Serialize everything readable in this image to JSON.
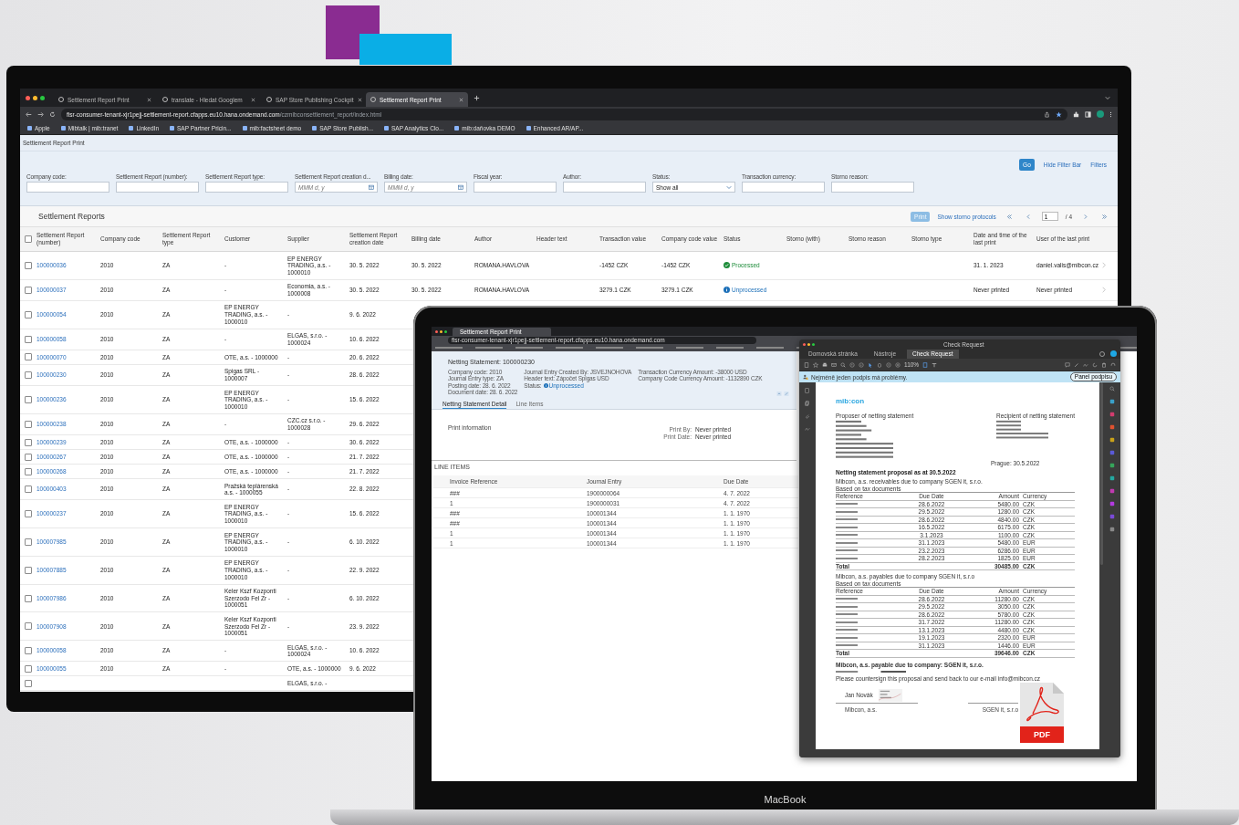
{
  "monitor": {
    "browser": {
      "tabs": [
        {
          "title": "Settlement Report Print",
          "selected": false
        },
        {
          "title": "translate - Hledat Googlem",
          "selected": false
        },
        {
          "title": "SAP Store Publishing Cockpit",
          "selected": false
        },
        {
          "title": "Settlement Report Print",
          "selected": true
        }
      ],
      "url_host": "fisr-consumer-tenant-xjr1pejj-settlement-report.cfapps.eu10.hana.ondemand.com",
      "url_path": "/czmibconsettlement_report/index.html",
      "bookmarks": [
        "Apple",
        "Mibtalk | mib:tranet",
        "LinkedIn",
        "SAP Partner Pricin...",
        "mib:factsheet demo",
        "SAP Store Publish...",
        "SAP Analytics Clo...",
        "mib:daňovka DEMO",
        "Enhanced AR/AP..."
      ]
    },
    "app_title": "Settlement Report Print",
    "filter_buttons": [
      {
        "label": "Go",
        "kind": "primary"
      },
      {
        "label": "Hide Filter Bar",
        "kind": "link"
      },
      {
        "label": "Filters",
        "kind": "link"
      }
    ],
    "filters": [
      {
        "label": "Company code:",
        "kind": "text"
      },
      {
        "label": "Settlement Report (number):",
        "kind": "text"
      },
      {
        "label": "Settlement Report type:",
        "kind": "text"
      },
      {
        "label": "Settlement Report creation d...",
        "kind": "date",
        "placeholder": "MMM d, y"
      },
      {
        "label": "Billing date:",
        "kind": "date",
        "placeholder": "MMM d, y"
      },
      {
        "label": "Fiscal year:",
        "kind": "text"
      },
      {
        "label": "Author:",
        "kind": "text"
      },
      {
        "label": "Status:",
        "kind": "select",
        "value": "Show all"
      },
      {
        "label": "Transaction currency:",
        "kind": "text"
      },
      {
        "label": "Storno reason:",
        "kind": "text"
      }
    ],
    "table": {
      "title": "Settlement Reports",
      "print": {
        "label": "Print",
        "disabled": true
      },
      "storno_link": "Show storno protocols",
      "page": "1",
      "pages": "/ 4",
      "all_checked": false,
      "columns": [
        "Settlement Report (number)",
        "Company code",
        "Settlement Report type",
        "Customer",
        "Supplier",
        "Settlement Report creation date",
        "Billing date",
        "Author",
        "Header text",
        "Transaction value",
        "Company code value",
        "Status",
        "Storno (with)",
        "Storno reason",
        "Storno type",
        "Date and time of the last print",
        "User of the last print"
      ],
      "rows": [
        {
          "checked": false,
          "number": "100000036",
          "company_code": "2010",
          "type": "ZA",
          "customer": "-",
          "supplier": "EP ENERGY TRADING, a.s. - 1000010",
          "creation_date": "30. 5. 2022",
          "billing_date": "30. 5. 2022",
          "author": "ROMANA.HAVLOVA",
          "transaction_value": "-1452 CZK",
          "company_code_value": "-1452 CZK",
          "status": {
            "text": "Processed",
            "kind": "success"
          },
          "last_print": "31. 1. 2023",
          "last_user": "daniel.valis@mibcon.cz",
          "openable": true
        },
        {
          "checked": false,
          "number": "100000037",
          "company_code": "2010",
          "type": "ZA",
          "customer": "-",
          "supplier": "Economia, a.s. - 1000008",
          "creation_date": "30. 5. 2022",
          "billing_date": "30. 5. 2022",
          "author": "ROMANA.HAVLOVA",
          "transaction_value": "3279.1 CZK",
          "company_code_value": "3279.1 CZK",
          "status": {
            "text": "Unprocessed",
            "kind": "info"
          },
          "last_print": "Never printed",
          "last_user": "Never printed",
          "openable": true
        },
        {
          "checked": false,
          "number": "100000054",
          "company_code": "2010",
          "type": "ZA",
          "customer": "EP ENERGY TRADING, a.s. - 1000010",
          "supplier": "-",
          "creation_date": "9. 6. 2022"
        },
        {
          "checked": false,
          "number": "100000058",
          "company_code": "2010",
          "type": "ZA",
          "customer": "-",
          "supplier": "ELGAS, s.r.o. - 1000024",
          "creation_date": "10. 6. 2022"
        },
        {
          "checked": false,
          "number": "100000070",
          "company_code": "2010",
          "type": "ZA",
          "customer": "OTE, a.s. - 1000000",
          "supplier": "-",
          "creation_date": "20. 6. 2022"
        },
        {
          "checked": false,
          "number": "100000230",
          "company_code": "2010",
          "type": "ZA",
          "customer": "Spigas SRL - 1000007",
          "supplier": "-",
          "creation_date": "28. 6. 2022"
        },
        {
          "checked": false,
          "number": "100000236",
          "company_code": "2010",
          "type": "ZA",
          "customer": "EP ENERGY TRADING, a.s. - 1000010",
          "supplier": "-",
          "creation_date": "15. 6. 2022"
        },
        {
          "checked": false,
          "number": "100000238",
          "company_code": "2010",
          "type": "ZA",
          "customer": "-",
          "supplier": "CZC.cz s.r.o. - 1000028",
          "creation_date": "29. 6. 2022"
        },
        {
          "checked": false,
          "number": "100000239",
          "company_code": "2010",
          "type": "ZA",
          "customer": "OTE, a.s. - 1000000",
          "supplier": "-",
          "creation_date": "30. 6. 2022"
        },
        {
          "checked": false,
          "number": "100000267",
          "company_code": "2010",
          "type": "ZA",
          "customer": "OTE, a.s. - 1000000",
          "supplier": "-",
          "creation_date": "21. 7. 2022"
        },
        {
          "checked": false,
          "number": "100000268",
          "company_code": "2010",
          "type": "ZA",
          "customer": "OTE, a.s. - 1000000",
          "supplier": "-",
          "creation_date": "21. 7. 2022"
        },
        {
          "checked": false,
          "number": "100000403",
          "company_code": "2010",
          "type": "ZA",
          "customer": "Pražská teplárenská a.s. - 1000055",
          "supplier": "-",
          "creation_date": "22. 8. 2022"
        },
        {
          "checked": false,
          "number": "100000237",
          "company_code": "2010",
          "type": "ZA",
          "customer": "EP ENERGY TRADING, a.s. - 1000010",
          "supplier": "-",
          "creation_date": "15. 6. 2022"
        },
        {
          "checked": false,
          "number": "100007985",
          "company_code": "2010",
          "type": "ZA",
          "customer": "EP ENERGY TRADING, a.s. - 1000010",
          "supplier": "-",
          "creation_date": "6. 10. 2022"
        },
        {
          "checked": false,
          "number": "100007885",
          "company_code": "2010",
          "type": "ZA",
          "customer": "EP ENERGY TRADING, a.s. - 1000010",
          "supplier": "-",
          "creation_date": "22. 9. 2022"
        },
        {
          "checked": false,
          "number": "100007986",
          "company_code": "2010",
          "type": "ZA",
          "customer": "Keler Kszf Kozponti Szerzodo Fel Zr - 1000051",
          "supplier": "-",
          "creation_date": "6. 10. 2022"
        },
        {
          "checked": false,
          "number": "100007908",
          "company_code": "2010",
          "type": "ZA",
          "customer": "Keler Kszf Kozponti Szerzodo Fel Zr - 1000051",
          "supplier": "-",
          "creation_date": "23. 9. 2022"
        },
        {
          "checked": false,
          "number": "100000058",
          "company_code": "2010",
          "type": "ZA",
          "customer": "-",
          "supplier": "ELGAS, s.r.o. - 1000024",
          "creation_date": "10. 6. 2022"
        },
        {
          "checked": false,
          "number": "100000055",
          "company_code": "2010",
          "type": "ZA",
          "customer": "-",
          "supplier": "OTE, a.s. - 1000000",
          "creation_date": "9. 6. 2022"
        },
        {
          "checked": false,
          "supplier": "ELGAS, s.r.o. -"
        }
      ]
    }
  },
  "laptop": {
    "brand": "MacBook",
    "browser": {
      "tabs": [
        {
          "title": "Settlement Report Print",
          "selected": true
        }
      ],
      "url_host": "fisr-consumer-tenant-xjr1pejj-settlement-report.cfapps.eu10.hana.ondemand.com"
    },
    "netting": {
      "title": "Netting Statement: 100000230",
      "details": [
        [
          "Company code: 2010",
          "Journal Entry type: ZA",
          "Posting date: 28. 6. 2022",
          "Document date: 28. 6. 2022"
        ],
        [
          "Journal Entry Created By: JSVEJNOHOVA",
          "Header text: Zápočet Spigas USD"
        ],
        [
          "Transaction Currency Amount: -38000 USD",
          "Company Code Currency Amount: -1132890 CZK"
        ]
      ],
      "status_label": "Status:",
      "status": {
        "text": "Unprocessed",
        "kind": "info"
      },
      "tabs": [
        {
          "label": "Netting Statement Detail",
          "selected": true
        },
        {
          "label": "Line Items",
          "selected": false
        }
      ],
      "print_title": "Print information",
      "print_fields": [
        {
          "label": "Print By:",
          "value": "Never printed"
        },
        {
          "label": "Print Date:",
          "value": "Never printed"
        }
      ],
      "line_items": {
        "title": "LINE ITEMS",
        "columns": [
          "Invoice Reference",
          "Journal Entry",
          "Due Date"
        ],
        "rows": [
          [
            "###",
            "1900000064",
            "4. 7. 2022"
          ],
          [
            "1",
            "1900000031",
            "4. 7. 2022"
          ],
          [
            "###",
            "100001344",
            "1. 1. 1970"
          ],
          [
            "###",
            "100001344",
            "1. 1. 1970"
          ],
          [
            "1",
            "100001344",
            "1. 1. 1970"
          ],
          [
            "1",
            "100001344",
            "1. 1. 1970"
          ]
        ]
      }
    },
    "pdf_viewer": {
      "title": "Check Request",
      "tabs": [
        {
          "label": "Domovská stránka",
          "selected": false
        },
        {
          "label": "Nástroje",
          "selected": false
        },
        {
          "label": "Check Request",
          "selected": true
        }
      ],
      "zoom": "110%",
      "notice": "Nejméně jeden podpis má problémy.",
      "notice_button": "Panel podpisu",
      "document": {
        "logo": "mib:con",
        "proposer_title": "Proposer of netting statement",
        "recipient_title": "Recipient of netting statement",
        "place_date": "Prague: 30.5.2022",
        "heading": "Netting statement proposal as at 30.5.2022",
        "sections": [
          {
            "title": "Mibcon, a.s. receivables due to company SGEN it, s.r.o.",
            "basis": "Based on tax documents",
            "columns": [
              "Reference",
              "Due Date",
              "Amount",
              "Currency"
            ],
            "rows": [
              {
                "due": "28.6.2022",
                "amount": "5480.00",
                "currency": "CZK"
              },
              {
                "due": "29.5.2022",
                "amount": "1280.00",
                "currency": "CZK"
              },
              {
                "due": "28.6.2022",
                "amount": "4840.00",
                "currency": "CZK"
              },
              {
                "due": "16.5.2022",
                "amount": "6175.00",
                "currency": "CZK"
              },
              {
                "due": "3.1.2023",
                "amount": "1100.00",
                "currency": "CZK"
              },
              {
                "due": "31.1.2023",
                "amount": "5480.00",
                "currency": "EUR"
              },
              {
                "due": "23.2.2023",
                "amount": "6286.00",
                "currency": "EUR"
              },
              {
                "due": "28.2.2023",
                "amount": "1825.00",
                "currency": "EUR"
              }
            ],
            "total": {
              "label": "Total",
              "amount": "30485.00",
              "currency": "CZK"
            }
          },
          {
            "title": "Mibcon, a.s. payables due to company SGEN it, s.r.o",
            "basis": "Based on tax documents",
            "columns": [
              "Reference",
              "Due Date",
              "Amount",
              "Currency"
            ],
            "rows": [
              {
                "due": "28.6.2022",
                "amount": "11280.00",
                "currency": "CZK"
              },
              {
                "due": "29.5.2022",
                "amount": "3050.00",
                "currency": "CZK"
              },
              {
                "due": "28.6.2022",
                "amount": "5780.00",
                "currency": "CZK"
              },
              {
                "due": "31.7.2022",
                "amount": "11280.00",
                "currency": "CZK"
              },
              {
                "due": "13.1.2023",
                "amount": "4480.00",
                "currency": "CZK"
              },
              {
                "due": "19.1.2023",
                "amount": "2320.00",
                "currency": "EUR"
              },
              {
                "due": "31.1.2023",
                "amount": "1446.00",
                "currency": "EUR"
              }
            ],
            "total": {
              "label": "Total",
              "amount": "39646.00",
              "currency": "CZK"
            }
          }
        ],
        "payment_title": "Mibcon, a.s. payable due to company: SGEN it, s.r.o.",
        "request": "Please countersign this proposal and send back to our e-mail info@mibcon.cz",
        "signer": "Jan Novák",
        "signatures": [
          "Mibcon, a.s.",
          "SGEN it, s.r.o"
        ]
      }
    },
    "pdf_badge": "PDF"
  }
}
